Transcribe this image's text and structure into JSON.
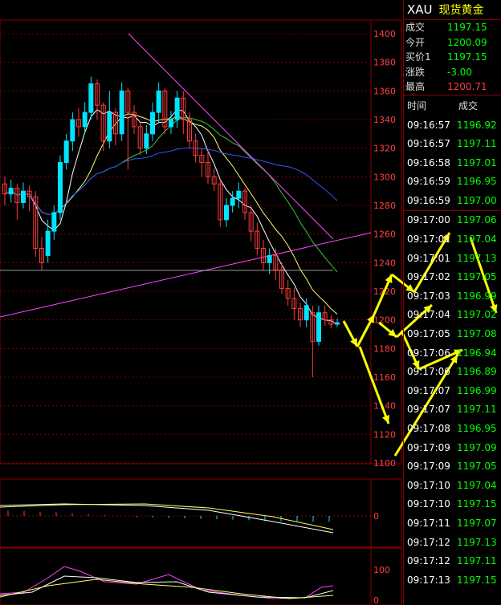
{
  "colors": {
    "up": "#00e5ff",
    "down": "#ff3b3b",
    "grid": "#8b0000",
    "axis": "#ff4040",
    "accent": "#ffff00",
    "price_green": "#00ff00",
    "price_red": "#ff3b3b"
  },
  "chart_data": {
    "type": "candlestick",
    "ylim": [
      1100,
      1400
    ],
    "y_ticks": [
      "1400",
      "1380",
      "1360",
      "1340",
      "1320",
      "1300",
      "1280",
      "1260",
      "1240",
      "1220",
      "1200",
      "1180",
      "1160",
      "1140",
      "1120",
      "1100"
    ],
    "candles": [
      [
        1295,
        1288,
        1300,
        1280
      ],
      [
        1288,
        1292,
        1298,
        1282
      ],
      [
        1292,
        1282,
        1295,
        1270
      ],
      [
        1282,
        1290,
        1296,
        1278
      ],
      [
        1290,
        1286,
        1294,
        1276
      ],
      [
        1286,
        1250,
        1290,
        1244
      ],
      [
        1250,
        1240,
        1258,
        1235
      ],
      [
        1245,
        1262,
        1270,
        1240
      ],
      [
        1262,
        1275,
        1280,
        1256
      ],
      [
        1275,
        1310,
        1315,
        1270
      ],
      [
        1310,
        1325,
        1330,
        1305
      ],
      [
        1325,
        1340,
        1345,
        1318
      ],
      [
        1340,
        1335,
        1348,
        1328
      ],
      [
        1335,
        1345,
        1352,
        1330
      ],
      [
        1345,
        1365,
        1370,
        1340
      ],
      [
        1365,
        1350,
        1368,
        1340
      ],
      [
        1350,
        1325,
        1352,
        1318
      ],
      [
        1325,
        1345,
        1360,
        1320
      ],
      [
        1345,
        1330,
        1348,
        1322
      ],
      [
        1330,
        1360,
        1366,
        1325
      ],
      [
        1360,
        1345,
        1362,
        1305
      ],
      [
        1345,
        1335,
        1350,
        1330
      ],
      [
        1335,
        1320,
        1338,
        1315
      ],
      [
        1320,
        1330,
        1336,
        1316
      ],
      [
        1330,
        1345,
        1352,
        1325
      ],
      [
        1345,
        1360,
        1366,
        1338
      ],
      [
        1360,
        1335,
        1362,
        1330
      ],
      [
        1335,
        1340,
        1346,
        1330
      ],
      [
        1340,
        1355,
        1360,
        1334
      ],
      [
        1355,
        1340,
        1360,
        1330
      ],
      [
        1340,
        1325,
        1345,
        1320
      ],
      [
        1325,
        1315,
        1330,
        1310
      ],
      [
        1315,
        1310,
        1320,
        1300
      ],
      [
        1310,
        1300,
        1318,
        1295
      ],
      [
        1300,
        1295,
        1306,
        1290
      ],
      [
        1295,
        1270,
        1298,
        1265
      ],
      [
        1270,
        1280,
        1285,
        1265
      ],
      [
        1280,
        1285,
        1290,
        1275
      ],
      [
        1285,
        1290,
        1296,
        1278
      ],
      [
        1290,
        1275,
        1292,
        1270
      ],
      [
        1275,
        1262,
        1280,
        1255
      ],
      [
        1262,
        1250,
        1268,
        1245
      ],
      [
        1250,
        1240,
        1256,
        1235
      ],
      [
        1240,
        1245,
        1250,
        1232
      ],
      [
        1245,
        1235,
        1250,
        1228
      ],
      [
        1235,
        1222,
        1240,
        1218
      ],
      [
        1222,
        1215,
        1228,
        1210
      ],
      [
        1215,
        1208,
        1222,
        1200
      ],
      [
        1208,
        1200,
        1212,
        1195
      ],
      [
        1200,
        1210,
        1215,
        1195
      ],
      [
        1205,
        1185,
        1210,
        1160
      ],
      [
        1185,
        1205,
        1210,
        1182
      ],
      [
        1205,
        1200,
        1210,
        1196
      ],
      [
        1200,
        1197,
        1203,
        1194
      ],
      [
        1197,
        1198,
        1201,
        1195
      ]
    ],
    "macd": [
      0.55,
      0.5,
      0.45,
      0.4,
      0.3,
      0.2,
      0.1,
      0.0,
      -0.1,
      -0.15,
      -0.2,
      -0.25,
      -0.3,
      -0.35,
      -0.4,
      -0.45,
      -0.5,
      -0.55,
      -0.55,
      -0.6,
      -0.6
    ],
    "macd_ticks": [
      "0"
    ],
    "rsi_ticks": [
      "100",
      "0"
    ]
  },
  "sidebar": {
    "symbol": "XAU",
    "name": "现货黄金",
    "quotes": [
      {
        "label": "成交",
        "value": "1197.15",
        "color": "#00ff00"
      },
      {
        "label": "今开",
        "value": "1200.09",
        "color": "#00ff00"
      },
      {
        "label": "买价1",
        "value": "1197.15",
        "color": "#00ff00"
      },
      {
        "label": "涨跌",
        "value": "-3.00",
        "color": "#00ff00"
      },
      {
        "label": "最高",
        "value": "1200.71",
        "color": "#ff3b3b"
      }
    ],
    "col_time": "时间",
    "col_price": "成交",
    "ticks_a": [
      {
        "t": "09:16:57",
        "p": "1196.92"
      },
      {
        "t": "09:16:57",
        "p": "1197.11"
      },
      {
        "t": "09:16:58",
        "p": "1197.01"
      },
      {
        "t": "09:16:59",
        "p": "1196.95"
      },
      {
        "t": "09:16:59",
        "p": "1197.00"
      }
    ],
    "ticks_b": [
      {
        "t": "09:17:00",
        "p": "1197.06"
      },
      {
        "t": "09:17:01",
        "p": "1197.04"
      },
      {
        "t": "09:17:01",
        "p": "1197.13"
      },
      {
        "t": "09:17:02",
        "p": "1197.05"
      },
      {
        "t": "09:17:03",
        "p": "1196.99"
      },
      {
        "t": "09:17:04",
        "p": "1197.02"
      },
      {
        "t": "09:17:05",
        "p": "1197.08"
      },
      {
        "t": "09:17:06",
        "p": "1196.94"
      },
      {
        "t": "09:17:06",
        "p": "1196.89"
      },
      {
        "t": "09:17:07",
        "p": "1196.99"
      },
      {
        "t": "09:17:07",
        "p": "1197.11"
      },
      {
        "t": "09:17:08",
        "p": "1196.95"
      },
      {
        "t": "09:17:09",
        "p": "1197.09"
      },
      {
        "t": "09:17:09",
        "p": "1197.05"
      },
      {
        "t": "09:17:10",
        "p": "1197.04"
      },
      {
        "t": "09:17:10",
        "p": "1197.15"
      },
      {
        "t": "09:17:11",
        "p": "1197.07"
      },
      {
        "t": "09:17:12",
        "p": "1197.13"
      },
      {
        "t": "09:17:12",
        "p": "1197.11"
      },
      {
        "t": "09:17:13",
        "p": "1197.15"
      }
    ]
  }
}
